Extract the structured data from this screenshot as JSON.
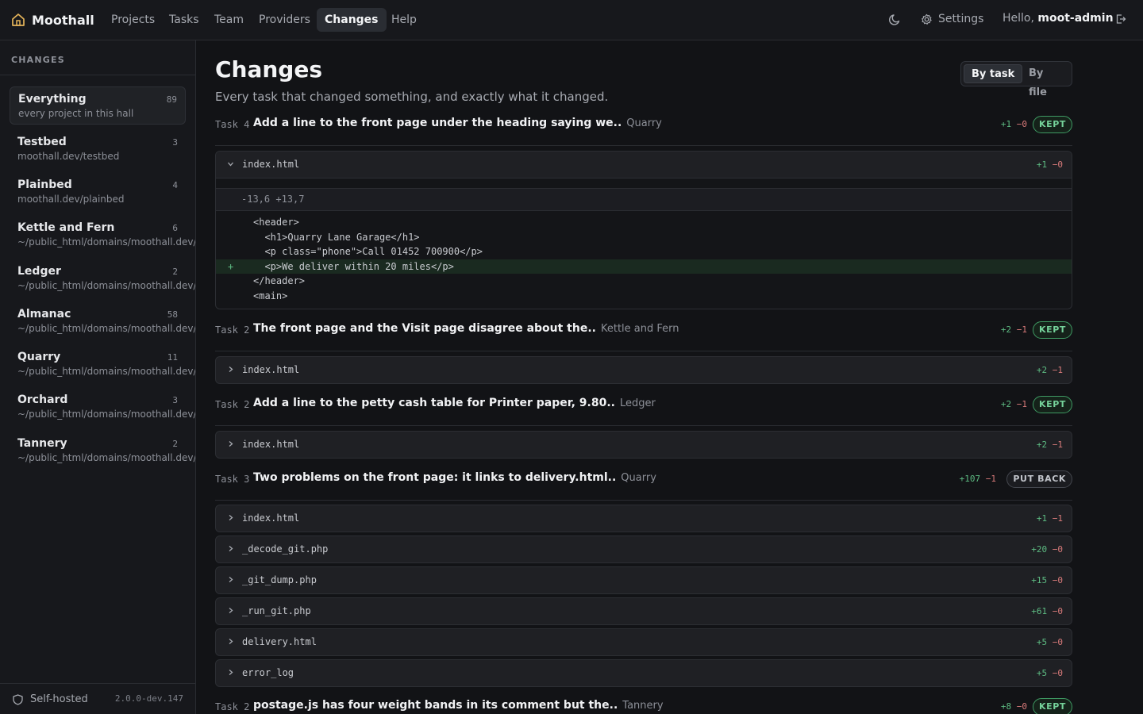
{
  "app": {
    "name": "Moothall"
  },
  "nav": {
    "items": [
      "Projects",
      "Tasks",
      "Team",
      "Providers",
      "Changes",
      "Help"
    ],
    "active": "Changes",
    "settings_label": "Settings",
    "hello_prefix": "Hello,",
    "username": "moot-admin"
  },
  "sidebar": {
    "title": "CHANGES",
    "projects": [
      {
        "name": "Everything",
        "count": "89",
        "sub": "every project in this hall",
        "active": true
      },
      {
        "name": "Testbed",
        "count": "3",
        "sub": "moothall.dev/testbed"
      },
      {
        "name": "Plainbed",
        "count": "4",
        "sub": "moothall.dev/plainbed"
      },
      {
        "name": "Kettle and Fern",
        "count": "6",
        "sub": "~/public_html/domains/moothall.dev/kettle"
      },
      {
        "name": "Ledger",
        "count": "2",
        "sub": "~/public_html/domains/moothall.dev/ledger"
      },
      {
        "name": "Almanac",
        "count": "58",
        "sub": "~/public_html/domains/moothall.dev/almanac"
      },
      {
        "name": "Quarry",
        "count": "11",
        "sub": "~/public_html/domains/moothall.dev/quarry"
      },
      {
        "name": "Orchard",
        "count": "3",
        "sub": "~/public_html/domains/moothall.dev/orchard"
      },
      {
        "name": "Tannery",
        "count": "2",
        "sub": "~/public_html/domains/moothall.dev/tannery"
      }
    ],
    "footer": {
      "label": "Self-hosted",
      "version": "2.0.0-dev.147"
    }
  },
  "main": {
    "title": "Changes",
    "subtitle": "Every task that changed something, and exactly what it changed.",
    "view_toggle": {
      "options": [
        "By task",
        "By file"
      ],
      "active": "By task"
    },
    "tasks": [
      {
        "label": "Task 4",
        "title": "Add a line to the front page under the heading saying we..",
        "project": "Quarry",
        "added": "+1",
        "removed": "−0",
        "status": "KEPT",
        "files": [
          {
            "name": "index.html",
            "added": "+1",
            "removed": "−0",
            "expanded": true,
            "hunk": "-13,6 +13,7",
            "lines": [
              {
                "sign": "",
                "code": "<header>"
              },
              {
                "sign": "",
                "code": "  <h1>Quarry Lane Garage</h1>"
              },
              {
                "sign": "",
                "code": "  <p class=\"phone\">Call 01452 700900</p>"
              },
              {
                "sign": "+",
                "code": "  <p>We deliver within 20 miles</p>",
                "added": true
              },
              {
                "sign": "",
                "code": "</header>"
              },
              {
                "sign": "",
                "code": "<main>"
              }
            ]
          }
        ]
      },
      {
        "label": "Task 2",
        "title": "The front page and the Visit page disagree about the..",
        "project": "Kettle and Fern",
        "added": "+2",
        "removed": "−1",
        "status": "KEPT",
        "files": [
          {
            "name": "index.html",
            "added": "+2",
            "removed": "−1"
          }
        ]
      },
      {
        "label": "Task 2",
        "title": "Add a line to the petty cash table for Printer paper, 9.80..",
        "project": "Ledger",
        "added": "+2",
        "removed": "−1",
        "status": "KEPT",
        "files": [
          {
            "name": "index.html",
            "added": "+2",
            "removed": "−1"
          }
        ]
      },
      {
        "label": "Task 3",
        "title": "Two problems on the front page: it links to delivery.html..",
        "project": "Quarry",
        "added": "+107",
        "removed": "−1",
        "status": "PUT BACK",
        "files": [
          {
            "name": "index.html",
            "added": "+1",
            "removed": "−1"
          },
          {
            "name": "_decode_git.php",
            "added": "+20",
            "removed": "−0"
          },
          {
            "name": "_git_dump.php",
            "added": "+15",
            "removed": "−0"
          },
          {
            "name": "_run_git.php",
            "added": "+61",
            "removed": "−0"
          },
          {
            "name": "delivery.html",
            "added": "+5",
            "removed": "−0"
          },
          {
            "name": "error_log",
            "added": "+5",
            "removed": "−0"
          }
        ]
      },
      {
        "label": "Task 2",
        "title": "postage.js has four weight bands in its comment but the..",
        "project": "Tannery",
        "added": "+8",
        "removed": "−0",
        "status": "KEPT",
        "files": []
      }
    ]
  },
  "colors": {
    "accent_added": "#5dbb82",
    "accent_removed": "#d97a7a",
    "kept": "#75d29a",
    "brand_icon": "#e5b45a"
  },
  "icons": {
    "brand": "home-icon",
    "theme": "moon-icon",
    "settings": "gear-icon",
    "logout": "logout-icon",
    "footer": "shield-icon",
    "file_toggle": "chevron-icon"
  }
}
